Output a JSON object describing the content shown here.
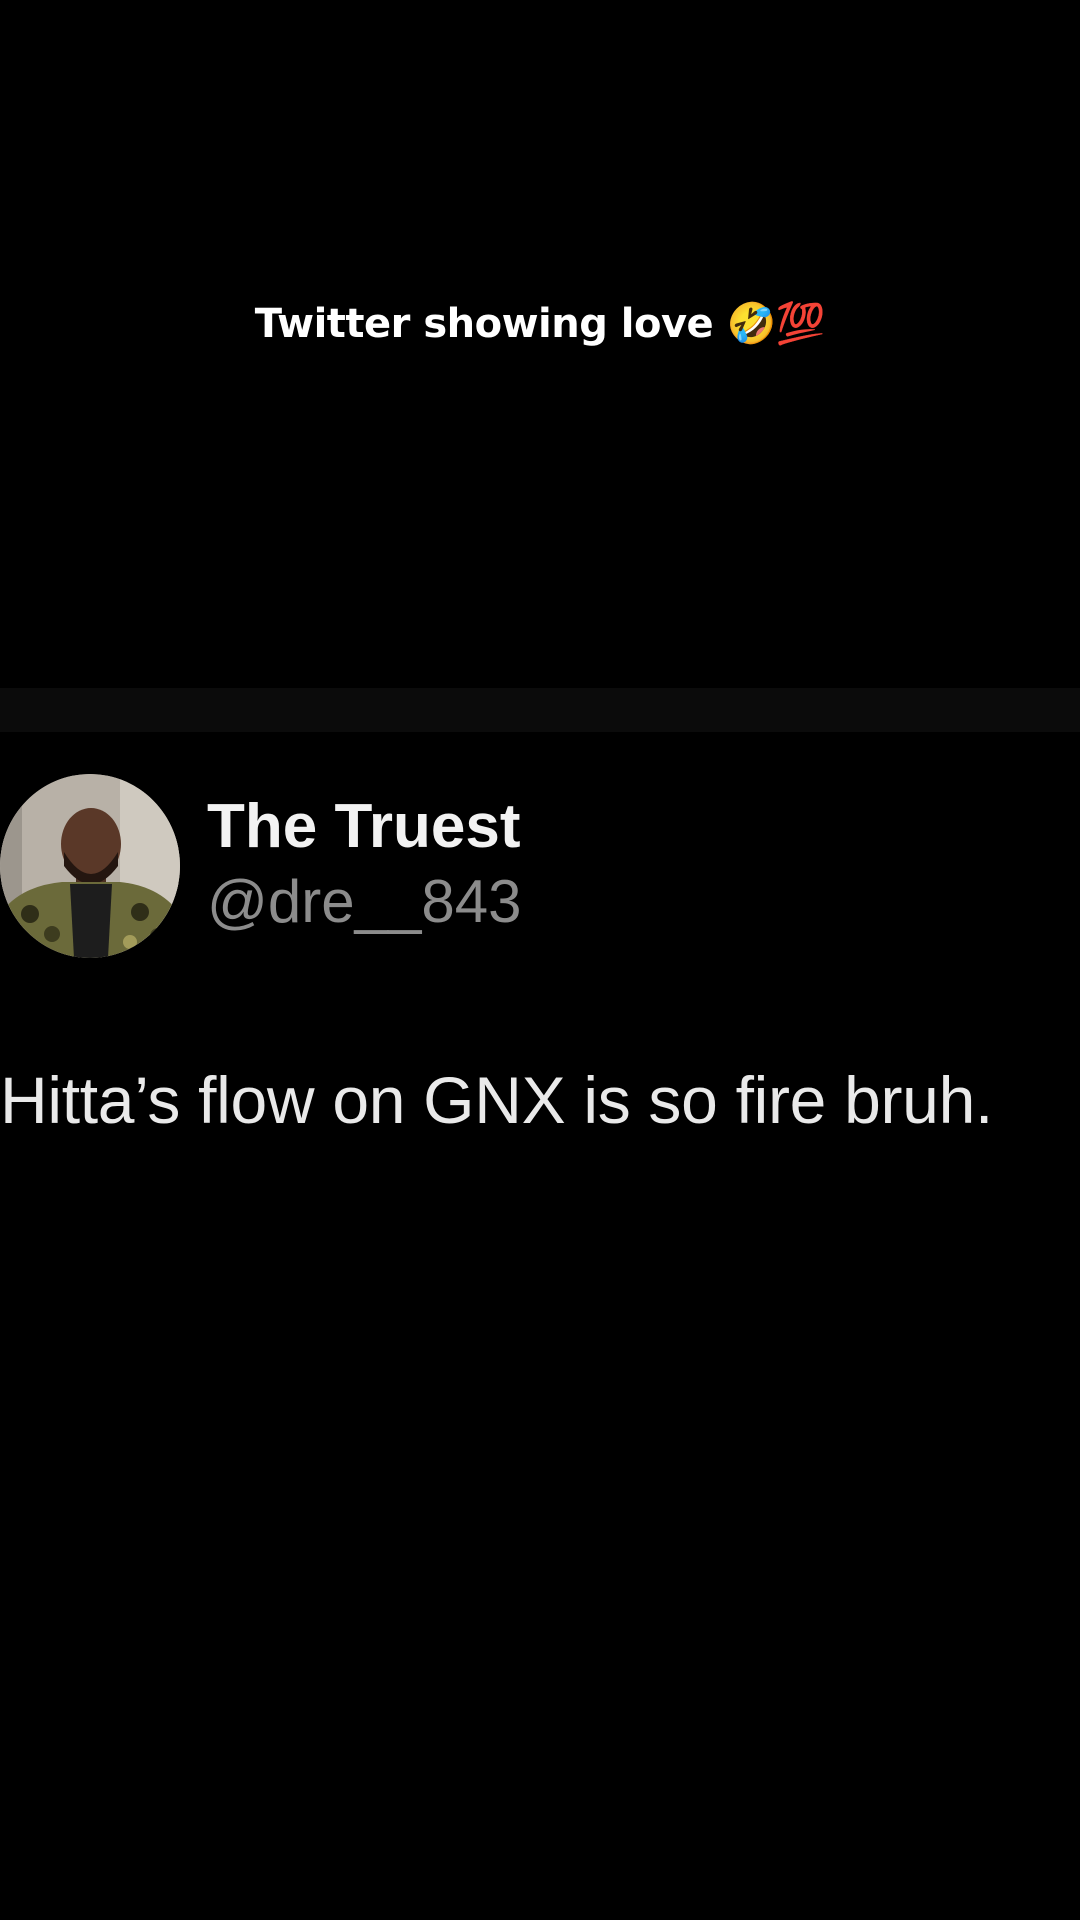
{
  "caption": {
    "text": "Twitter showing love 🤣💯"
  },
  "tweet": {
    "display_name": "The Truest",
    "handle": "@dre__843",
    "text": "Hitta’s flow on GNX is so fire bruh."
  },
  "colors": {
    "background": "#000000",
    "divider_band": "#0b0b0b",
    "display_name": "#f2f2f2",
    "handle": "#8c8c8c",
    "tweet_text": "#e9e9e9"
  }
}
